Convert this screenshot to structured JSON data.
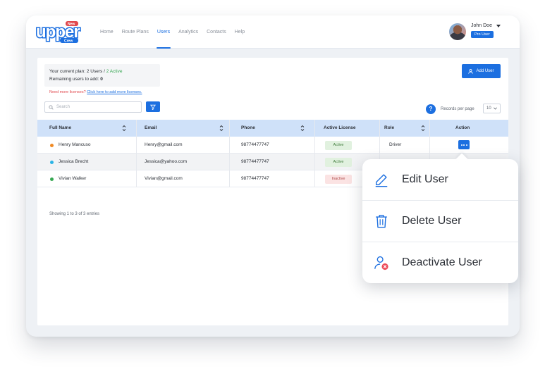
{
  "brand": {
    "logo_text": "upper",
    "logo_sub": "Crew",
    "logo_badge": "New"
  },
  "nav": [
    {
      "label": "Home",
      "active": false
    },
    {
      "label": "Route Plans",
      "active": false
    },
    {
      "label": "Users",
      "active": true
    },
    {
      "label": "Analytics",
      "active": false
    },
    {
      "label": "Contacts",
      "active": false
    },
    {
      "label": "Help",
      "active": false
    }
  ],
  "user": {
    "name": "John Doe",
    "badge": "Pro User"
  },
  "plan": {
    "prefix": "Your current plan: ",
    "users": "2 Users",
    "separator": " / ",
    "active": "2 Active",
    "remaining_label": "Remaining users to add: ",
    "remaining_value": "0"
  },
  "licenses": {
    "prompt": "Need more licenses?",
    "link": "Click here to add more licenses."
  },
  "toolbar": {
    "add_user": "Add User",
    "search_placeholder": "Search",
    "help": "?",
    "records_label": "Records per page",
    "records_value": "10"
  },
  "table": {
    "headers": [
      "Full Name",
      "Email",
      "Phone",
      "Active License",
      "Role",
      "Action"
    ],
    "rows": [
      {
        "name": "Henry Mancuso",
        "email": "Henry@gmail.com",
        "phone": "98774477747",
        "license": "Active",
        "role": "Driver",
        "dot": "#f08a24"
      },
      {
        "name": "Jessica Brecht",
        "email": "Jessica@yahoo.com",
        "phone": "98774477747",
        "license": "Active",
        "role": "",
        "dot": "#2ab4e6"
      },
      {
        "name": "Vivian Walker",
        "email": "Vivian@gmail.com",
        "phone": "98774477747",
        "license": "Inactive",
        "role": "",
        "dot": "#36a852"
      }
    ],
    "footer": "Showing 1 to 3 of 3 entries"
  },
  "context_menu": [
    {
      "label": "Edit User",
      "icon": "pencil-icon"
    },
    {
      "label": "Delete User",
      "icon": "trash-icon"
    },
    {
      "label": "Deactivate User",
      "icon": "user-remove-icon"
    }
  ],
  "colors": {
    "accent": "#1c6fe0",
    "header_bg": "#cfe1f9",
    "active_green": "#36a852",
    "danger": "#e0474c"
  }
}
